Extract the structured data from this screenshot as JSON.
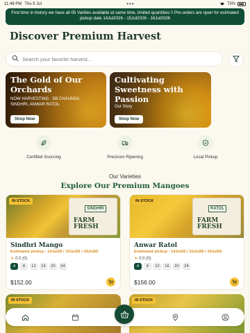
{
  "status": {
    "time": "11:48 PM",
    "date": "Thu 9 Jul",
    "battery": "73%"
  },
  "banner": {
    "text": "First time in history we have all 05 Varities available at same time, limited quantities !! Pre-orders are open for estimated pickup date 14Jul2026 - 15Jul2026 - 16Jul2026"
  },
  "page": {
    "title": "Discover Premium Harvest"
  },
  "search": {
    "placeholder": "Search your favorite harvest..."
  },
  "promos": [
    {
      "title": "The Gold of Our Orchards",
      "subtitle": "NOW HARVESTING : SB CHAUNSA, SINDHRI, ANWAR RATOL",
      "button": "Shop Now"
    },
    {
      "title": "Cultivating Sweetness with Passion",
      "subtitle": "Our Story",
      "button": "Shop Now"
    }
  ],
  "features": [
    {
      "label": "Certified Sourcing",
      "icon": "leaf-icon"
    },
    {
      "label": "Precision Ripening",
      "icon": "truck-icon"
    },
    {
      "label": "Local Pickup",
      "icon": "shield-check-icon"
    }
  ],
  "section": {
    "subtitle": "Our Varieties",
    "title": "Explore Our Premium Mangoes"
  },
  "products": [
    {
      "badge": "IN STOCK",
      "box_brand": "SINDHRI",
      "box_text": "FARM FRESH",
      "name": "Sindhri Mango",
      "pickup": "Estimated pickup : 14Jul26 / 15Jul26 / 16Jul26",
      "rating": "0.0 (0)",
      "quantities": [
        "4",
        "8",
        "12",
        "16",
        "20",
        "24"
      ],
      "price": "$152.00"
    },
    {
      "badge": "IN STOCK",
      "box_brand": "RATOL",
      "box_text": "FARM FRESH",
      "name": "Anwar Ratol",
      "pickup": "Estimated pickup : 14Jul26 / 15Jul26 / 16Jul26",
      "rating": "0.0 (0)",
      "quantities": [
        "4",
        "8",
        "12",
        "16",
        "20",
        "24"
      ],
      "price": "$156.00"
    },
    {
      "badge": "IN STOCK"
    },
    {
      "badge": "IN STOCK"
    }
  ],
  "tabbar": {
    "items": [
      "home-icon",
      "calendar-icon",
      "cart-icon",
      "location-icon",
      "user-icon"
    ]
  },
  "colors": {
    "brand": "#134d36",
    "accent": "#f3c033",
    "pickup": "#d48a1a"
  }
}
